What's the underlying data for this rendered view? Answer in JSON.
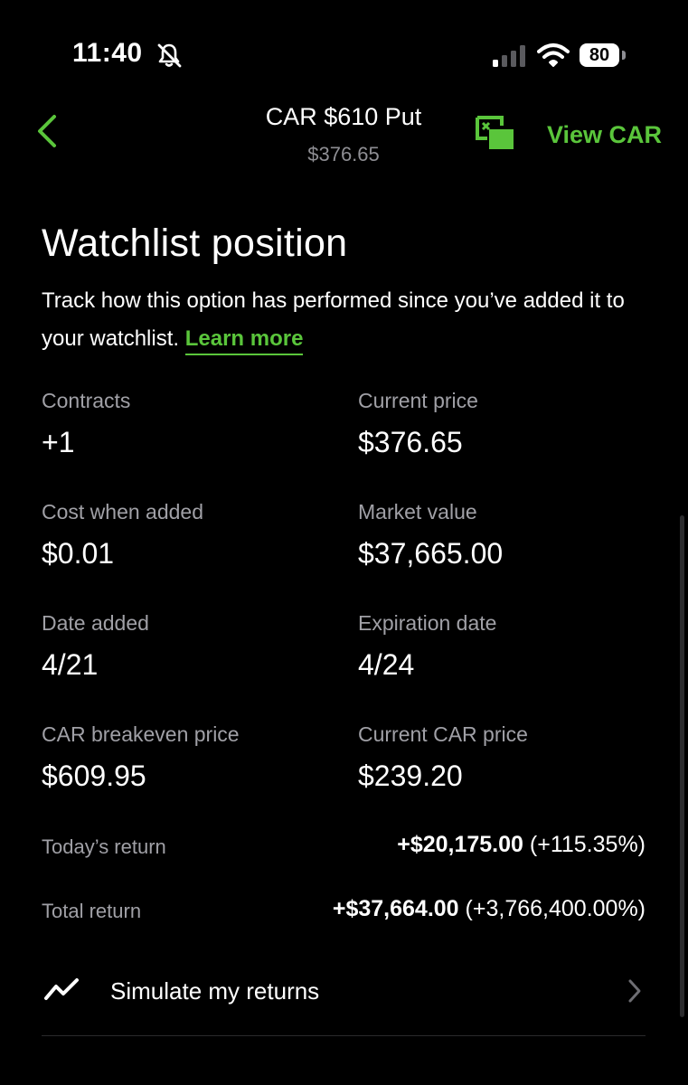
{
  "status_bar": {
    "time": "11:40",
    "battery": "80",
    "icons": [
      "bell-slash-icon",
      "cellular-signal-icon",
      "wifi-icon",
      "battery-icon"
    ]
  },
  "nav": {
    "title": "CAR $610 Put",
    "subtitle": "$376.65",
    "view_link": "View CAR",
    "icons": [
      "chevron-left-icon",
      "picture-in-picture-icon"
    ]
  },
  "section": {
    "heading": "Watchlist position",
    "description": "Track how this option has performed since you’ve added it to your watchlist.",
    "learn_more": "Learn more"
  },
  "stats": [
    {
      "label": "Contracts",
      "value": "+1"
    },
    {
      "label": "Current price",
      "value": "$376.65"
    },
    {
      "label": "Cost when added",
      "value": "$0.01"
    },
    {
      "label": "Market value",
      "value": "$37,665.00"
    },
    {
      "label": "Date added",
      "value": "4/21"
    },
    {
      "label": "Expiration date",
      "value": "4/24"
    },
    {
      "label": "CAR breakeven price",
      "value": "$609.95"
    },
    {
      "label": "Current CAR price",
      "value": "$239.20"
    }
  ],
  "returns": {
    "today": {
      "label": "Today’s return",
      "amount": "+$20,175.00",
      "percent": "(+115.35%)"
    },
    "total": {
      "label": "Total return",
      "amount": "+$37,664.00",
      "percent": "(+3,766,400.00%)"
    }
  },
  "simulate": {
    "label": "Simulate my returns",
    "icons": [
      "trend-line-icon",
      "chevron-right-icon"
    ]
  },
  "colors": {
    "accent": "#5ac53b",
    "background": "#000000",
    "muted_text": "#a0a0a6"
  }
}
